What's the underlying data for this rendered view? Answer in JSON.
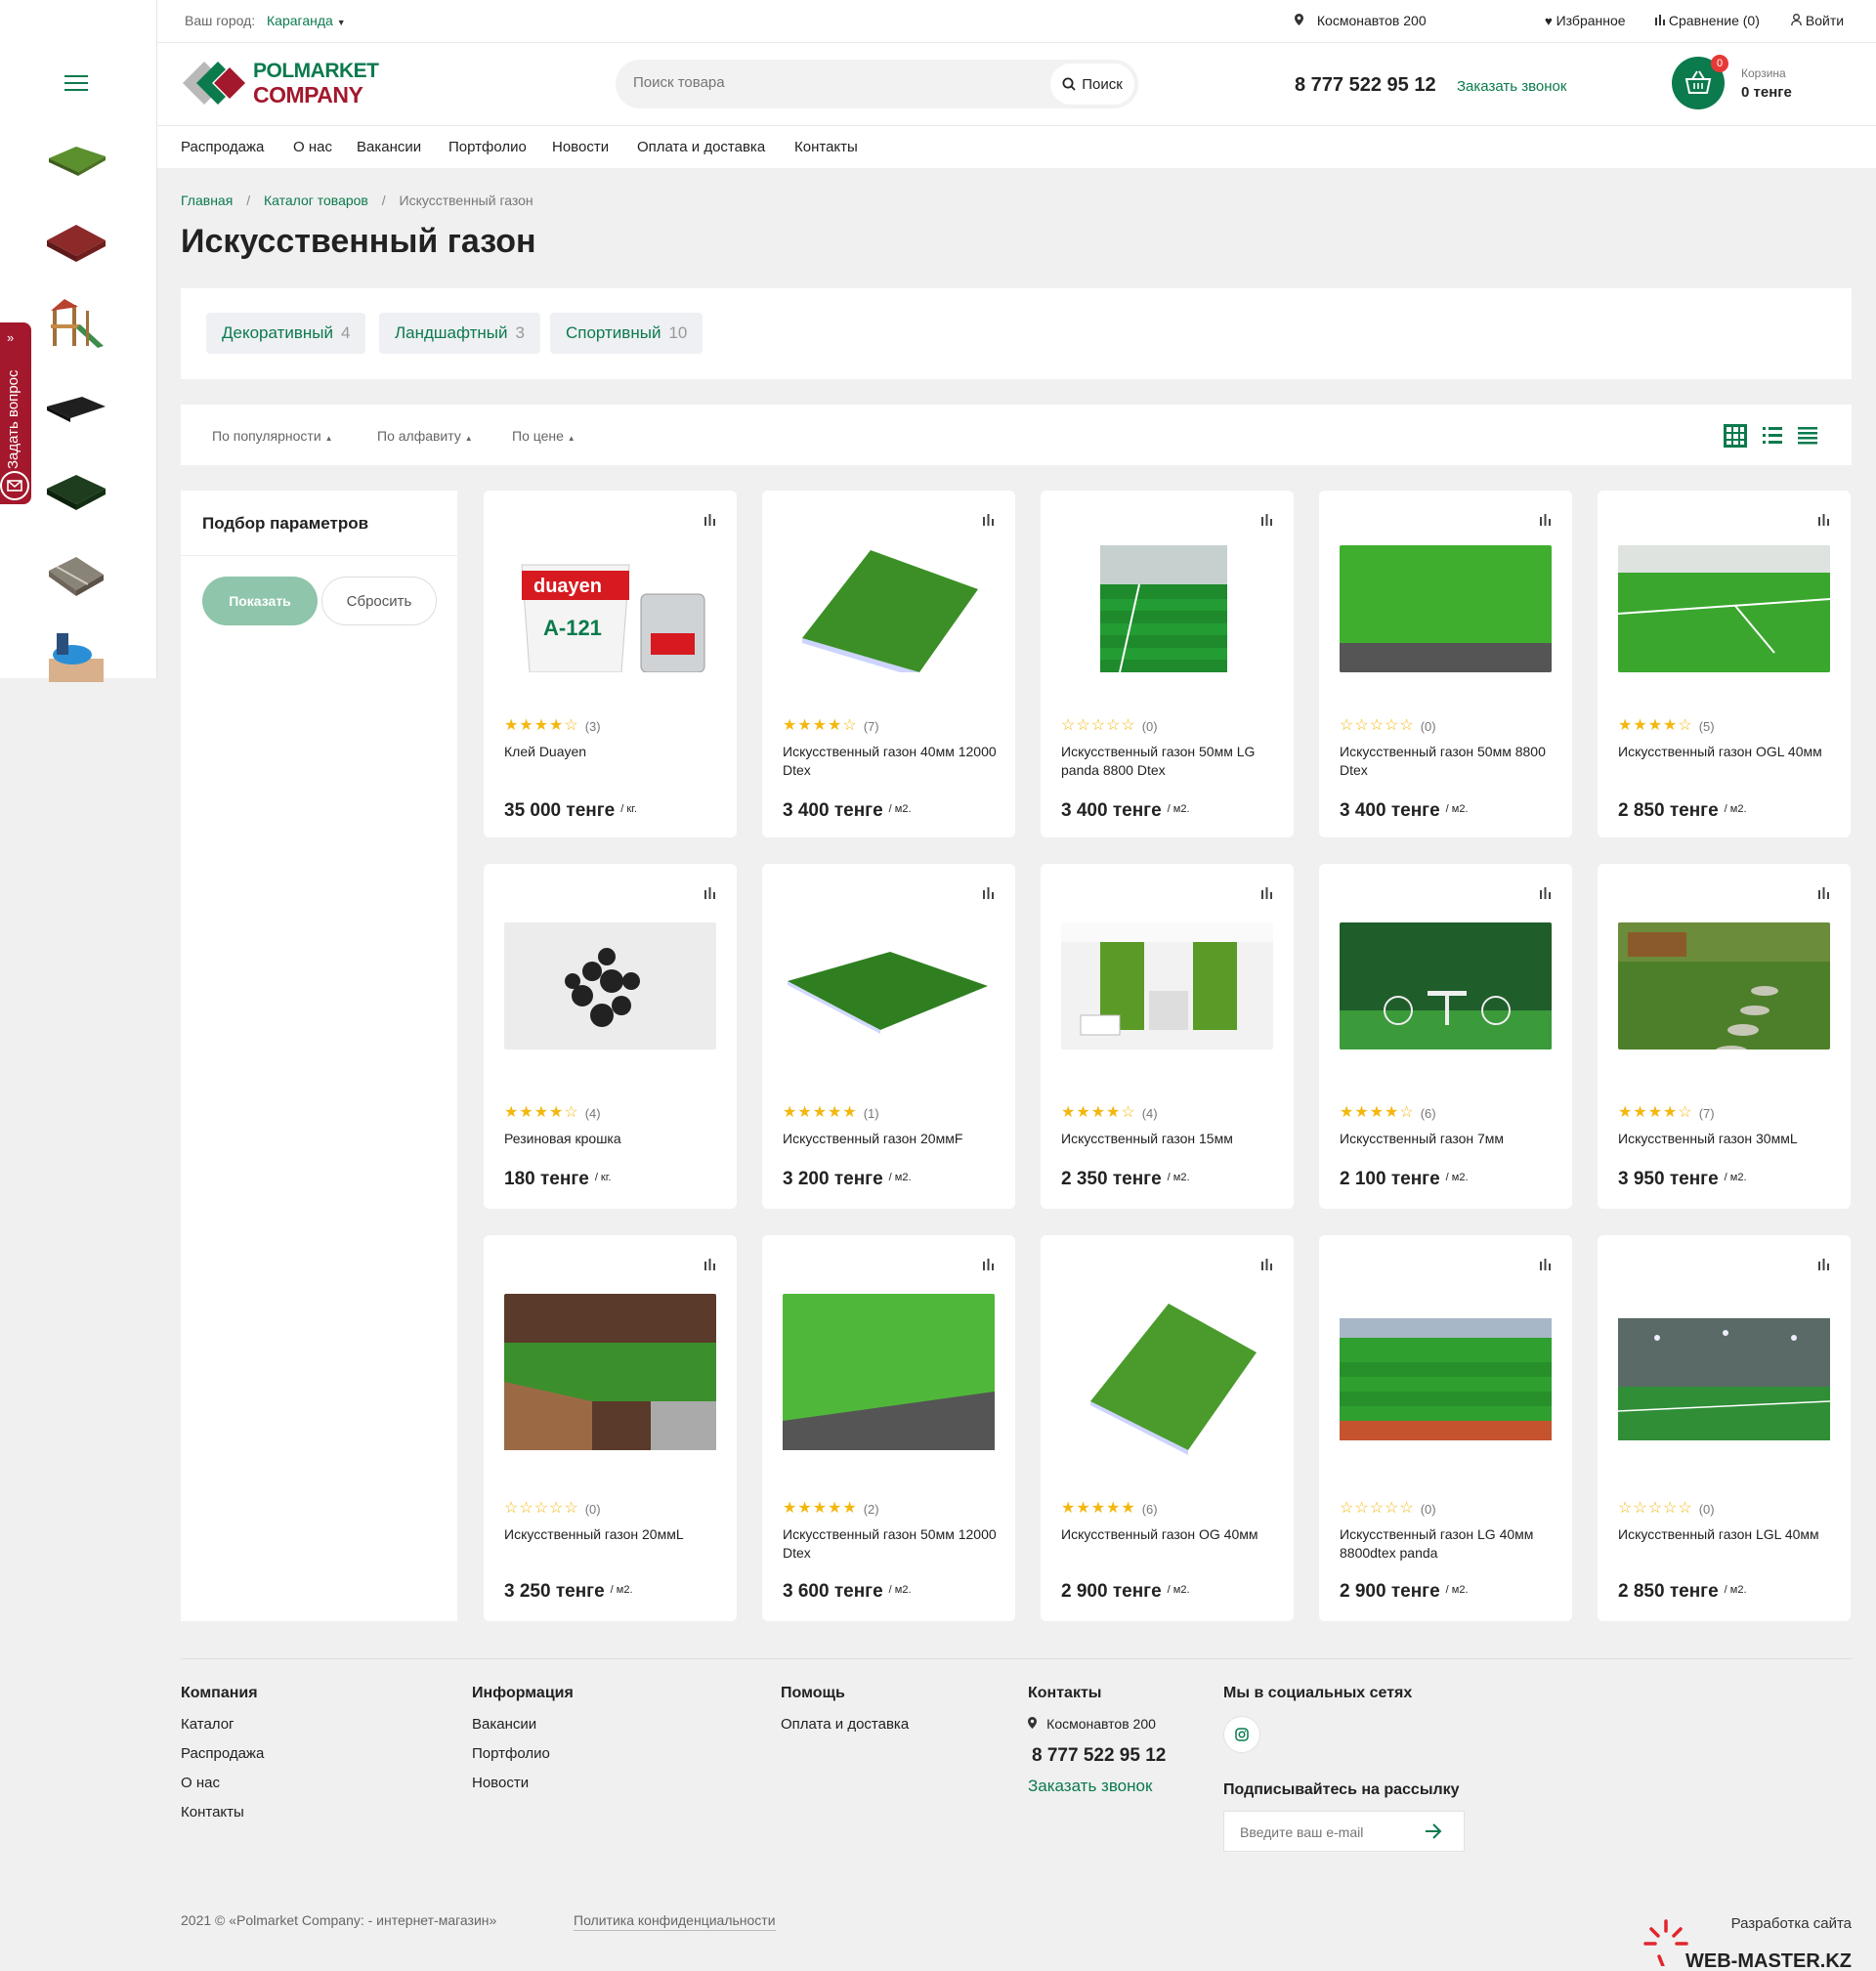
{
  "top": {
    "city_label": "Ваш город:",
    "city": "Караганда",
    "address": "Космонавтов 200",
    "favorites": "Избранное",
    "compare": "Сравнение (0)",
    "login": "Войти"
  },
  "header": {
    "logo_line1": "POLMARKET",
    "logo_line2": "COMPANY",
    "search_placeholder": "Поиск товара",
    "search_button": "Поиск",
    "phone": "8 777 522 95 12",
    "callback": "Заказать звонок",
    "cart_label": "Корзина",
    "cart_total": "0 тенге",
    "cart_count": "0"
  },
  "nav": [
    "Распродажа",
    "О нас",
    "Вакансии",
    "Портфолио",
    "Новости",
    "Оплата и доставка",
    "Контакты"
  ],
  "ask_question": "Задать вопрос",
  "breadcrumb": {
    "home": "Главная",
    "sep1": "/",
    "catalog": "Каталог товаров",
    "sep2": "/",
    "current": "Искусственный газон"
  },
  "page_title": "Искусственный газон",
  "categories": [
    {
      "label": "Декоративный",
      "count": "4"
    },
    {
      "label": "Ландшафтный",
      "count": "3"
    },
    {
      "label": "Спортивный",
      "count": "10"
    }
  ],
  "sort": {
    "popularity": "По популярности",
    "alphabet": "По алфавиту",
    "price": "По цене"
  },
  "filter": {
    "title": "Подбор параметров",
    "show": "Показать",
    "reset": "Сбросить"
  },
  "products": [
    {
      "name": "Клей Duayen",
      "rating": 4,
      "reviews": "(3)",
      "price": "35 000 тенге",
      "unit": "/ кг."
    },
    {
      "name": "Искусственный газон 40мм 12000 Dtex",
      "rating": 4,
      "reviews": "(7)",
      "price": "3 400 тенге",
      "unit": "/ м2."
    },
    {
      "name": "Искусственный газон 50мм LG panda 8800 Dtex",
      "rating": 0,
      "reviews": "(0)",
      "price": "3 400 тенге",
      "unit": "/ м2."
    },
    {
      "name": "Искусственный газон 50мм 8800 Dtex",
      "rating": 0,
      "reviews": "(0)",
      "price": "3 400 тенге",
      "unit": "/ м2."
    },
    {
      "name": "Искусственный газон OGL 40мм",
      "rating": 4,
      "reviews": "(5)",
      "price": "2 850 тенге",
      "unit": "/ м2."
    },
    {
      "name": "Резиновая крошка",
      "rating": 4,
      "reviews": "(4)",
      "price": "180 тенге",
      "unit": "/ кг."
    },
    {
      "name": "Искусственный газон 20ммF",
      "rating": 5,
      "reviews": "(1)",
      "price": "3 200 тенге",
      "unit": "/ м2."
    },
    {
      "name": "Искусственный газон 15мм",
      "rating": 4,
      "reviews": "(4)",
      "price": "2 350 тенге",
      "unit": "/ м2."
    },
    {
      "name": "Искусственный газон 7мм",
      "rating": 4,
      "reviews": "(6)",
      "price": "2 100 тенге",
      "unit": "/ м2."
    },
    {
      "name": "Искусственный газон 30ммL",
      "rating": 4,
      "reviews": "(7)",
      "price": "3 950 тенге",
      "unit": "/ м2."
    },
    {
      "name": "Искусственный газон 20ммL",
      "rating": 0,
      "reviews": "(0)",
      "price": "3 250 тенге",
      "unit": "/ м2."
    },
    {
      "name": "Искусственный газон 50мм 12000 Dtex",
      "rating": 5,
      "reviews": "(2)",
      "price": "3 600 тенге",
      "unit": "/ м2."
    },
    {
      "name": "Искусственный газон OG 40мм",
      "rating": 5,
      "reviews": "(6)",
      "price": "2 900 тенге",
      "unit": "/ м2."
    },
    {
      "name": "Искусственный газон LG 40мм 8800dtex panda",
      "rating": 0,
      "reviews": "(0)",
      "price": "2 900 тенге",
      "unit": "/ м2."
    },
    {
      "name": "Искусственный газон LGL 40мм",
      "rating": 0,
      "reviews": "(0)",
      "price": "2 850 тенге",
      "unit": "/ м2."
    }
  ],
  "footer": {
    "company": {
      "title": "Компания",
      "links": [
        "Каталог",
        "Распродажа",
        "О нас",
        "Контакты"
      ]
    },
    "info": {
      "title": "Информация",
      "links": [
        "Вакансии",
        "Портфолио",
        "Новости"
      ]
    },
    "help": {
      "title": "Помощь",
      "links": [
        "Оплата и доставка"
      ]
    },
    "contacts": {
      "title": "Контакты",
      "address": "Космонавтов 200",
      "phone": "8 777 522 95 12",
      "callback": "Заказать звонок"
    },
    "social_title": "Мы в социальных сетях",
    "subscribe_title": "Подписывайтесь на рассылку",
    "email_placeholder": "Введите ваш e-mail",
    "copyright": "2021 © «Polmarket Company: - интернет-магазин»",
    "policy": "Политика конфиденциальности",
    "dev_label": "Разработка сайта",
    "dev_name": "WEB-MASTER.KZ"
  },
  "colors": {
    "accent": "#0b7a4d",
    "brand_red": "#a3182c",
    "star": "#f4b70f"
  }
}
